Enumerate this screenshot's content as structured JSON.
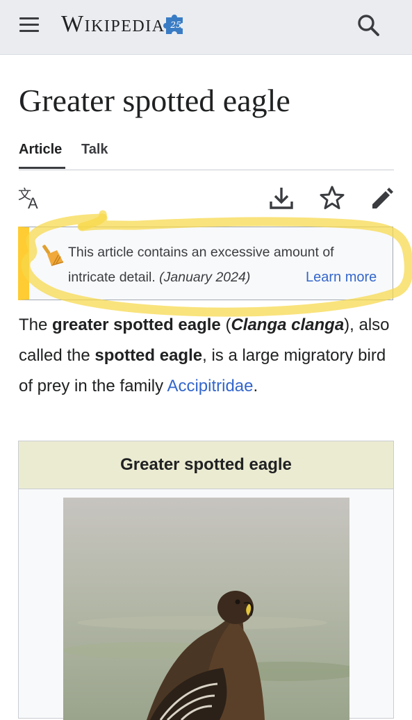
{
  "header": {
    "logo_text": "Wikipedia",
    "logo_badge": "25"
  },
  "article": {
    "title": "Greater spotted eagle"
  },
  "tabs": [
    {
      "label": "Article",
      "active": true
    },
    {
      "label": "Talk",
      "active": false
    }
  ],
  "toolbar": {
    "icons": [
      "language-icon",
      "download-icon",
      "watch-star-icon",
      "edit-pencil-icon"
    ]
  },
  "notice": {
    "text": "This article contains an excessive amount of intricate detail.",
    "date": "(January 2024)",
    "link": "Learn more",
    "accent_color": "#ffcc33"
  },
  "lead": {
    "part1": "The ",
    "bold1": "greater spotted eagle",
    "part2": " (",
    "italic_bold": "Clanga clanga",
    "part3": "), also called the ",
    "bold2": "spotted eagle",
    "part4": ", is a large migratory bird of prey in the family ",
    "link": "Accipitridae",
    "part5": "."
  },
  "infobox": {
    "title": "Greater spotted eagle"
  },
  "colors": {
    "link": "#3366cc",
    "highlighter": "#f7d84a",
    "infobox_header": "#ebebd2"
  }
}
